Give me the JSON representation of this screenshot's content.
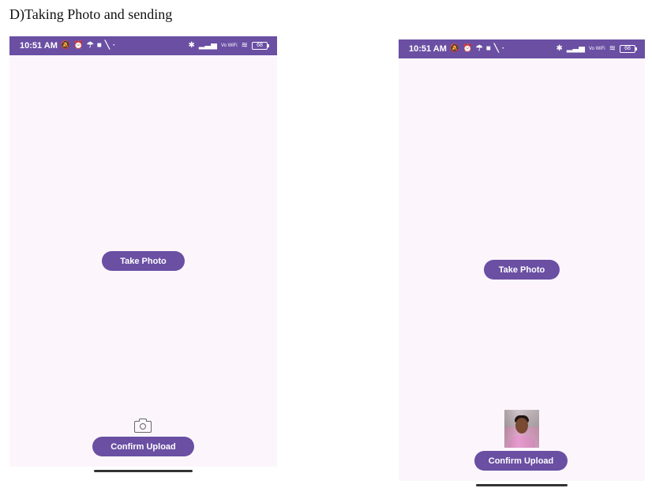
{
  "caption": "D)Taking Photo and sending",
  "colors": {
    "accent": "#6a4fa3",
    "screen_bg": "#fcf6fc"
  },
  "screens": [
    {
      "status_bar": {
        "time": "10:51 AM",
        "battery": "68",
        "network": "Vo WiFi"
      },
      "take_photo_label": "Take Photo",
      "preview": "camera-icon",
      "confirm_label": "Confirm Upload"
    },
    {
      "status_bar": {
        "time": "10:51 AM",
        "battery": "68",
        "network": "Vo WiFi"
      },
      "take_photo_label": "Take Photo",
      "preview": "captured-photo",
      "confirm_label": "Confirm Upload"
    }
  ]
}
